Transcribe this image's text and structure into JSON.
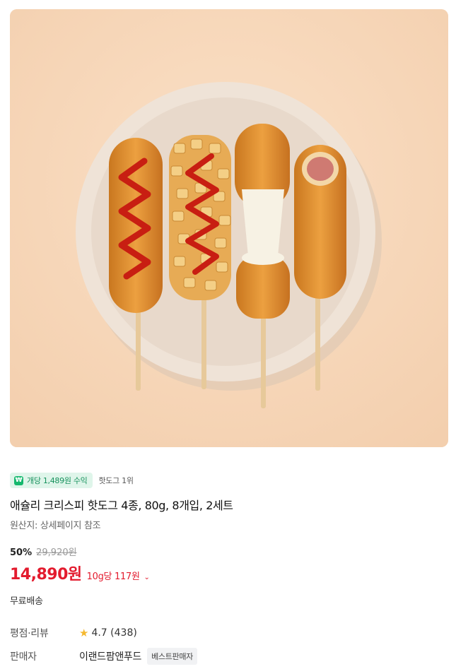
{
  "product": {
    "image_alt": "product-photo-four-hotdogs-on-plate",
    "earn_badge_icon": "won-icon",
    "earn_badge_icon_glyph": "₩",
    "earn_badge": "개당 1,489원 수익",
    "rank": "핫도그 1위",
    "title": "애슐리 크리스피 핫도그 4종, 80g, 8개입, 2세트",
    "origin": "원산지: 상세페이지 참조",
    "discount_rate": "50%",
    "original_price": "29,920원",
    "price": "14,890원",
    "unit_price": "10g당 117원",
    "unit_price_chevron": "⌄",
    "shipping": "무료배송",
    "rating_label": "평점·리뷰",
    "rating": "4.7 (438)",
    "seller_label": "판매자",
    "seller_name": "이랜드팜앤푸드",
    "seller_tag": "베스트판매자"
  },
  "colors": {
    "price_red": "#e31b2e",
    "badge_green": "#16915c",
    "badge_bg": "#dff5ea",
    "star": "#f5b82e"
  }
}
